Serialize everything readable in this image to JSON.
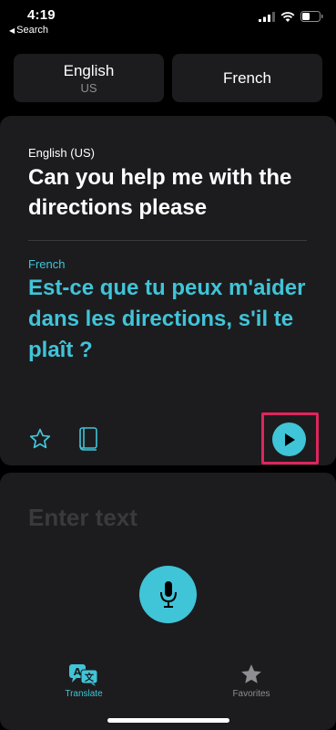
{
  "status_bar": {
    "time": "4:19",
    "back_label": "Search",
    "icons": [
      "cellular-signal-icon",
      "wifi-icon",
      "battery-icon"
    ]
  },
  "language_selector": {
    "source": {
      "name": "English",
      "region": "US"
    },
    "target": {
      "name": "French"
    }
  },
  "translation_card": {
    "source_label": "English (US)",
    "source_text": "Can you help me with the directions please",
    "target_label": "French",
    "target_text": "Est-ce que tu peux m'aider dans les directions, s'il te plaît ?",
    "actions": [
      "star-icon",
      "book-icon",
      "play-icon"
    ]
  },
  "input_area": {
    "placeholder": "Enter text",
    "mic_icon": "microphone-icon"
  },
  "tab_bar": {
    "tabs": [
      {
        "label": "Translate",
        "icon": "translate-icon",
        "active": true
      },
      {
        "label": "Favorites",
        "icon": "star-filled-icon",
        "active": false
      }
    ]
  },
  "colors": {
    "accent": "#40c4d8",
    "highlight_box": "#e0245e",
    "card_background": "#1c1c1e",
    "background": "#000000"
  }
}
